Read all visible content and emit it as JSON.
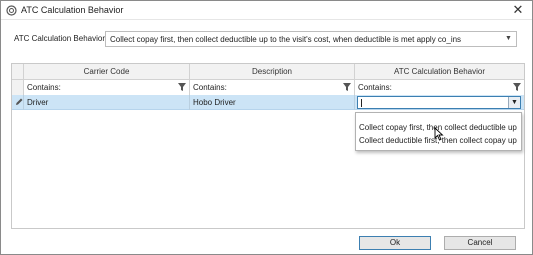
{
  "window": {
    "title": "ATC Calculation Behavior"
  },
  "field": {
    "label": "ATC Calculation Behavior",
    "value": "Collect copay first, then collect deductible up to the visit's cost, when deductible is met apply co_ins"
  },
  "grid": {
    "columns": [
      "Carrier Code",
      "Description",
      "ATC Calculation Behavior"
    ],
    "filter_label": "Contains:",
    "row": {
      "carrier_code": "Driver",
      "description": "Hobo Driver",
      "behavior": ""
    }
  },
  "dropdown": {
    "options": [
      "Collect copay first, then collect deductible up t...",
      "Collect deductible first, then collect copay up t..."
    ]
  },
  "buttons": {
    "ok": "Ok",
    "cancel": "Cancel"
  },
  "icons": [
    "app-icon",
    "close-icon",
    "chevron-down-icon",
    "filter-icon",
    "pencil-icon",
    "mouse-cursor-icon"
  ]
}
